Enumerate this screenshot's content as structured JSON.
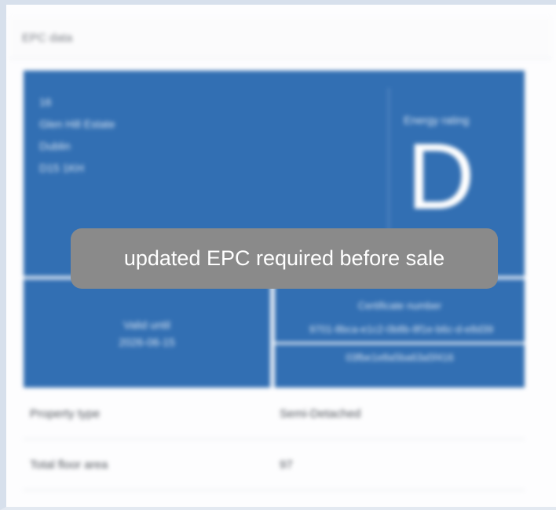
{
  "panel": {
    "title": "EPC data"
  },
  "address": [
    "16",
    "Glen Hill Estate",
    "Dublin",
    "D15 1KH"
  ],
  "energy_rating": {
    "label": "Energy rating",
    "letter": "D"
  },
  "valid_until": {
    "label": "Valid until",
    "date": "2026-06-15"
  },
  "certificate": {
    "label": "Certificate number",
    "number_line_1": "9701-8bca-e1c2-0b8b-8f1e-b6c-d-e8d39",
    "number_line_2": "03fbe1e8a5ba63a5f416"
  },
  "rows": [
    {
      "key": "Property type",
      "value": "Semi-Detached"
    },
    {
      "key": "Total floor area",
      "value": "97"
    }
  ],
  "toast": {
    "message": "updated EPC required before sale"
  },
  "colors": {
    "card": "#326fb3",
    "toast": "#8a8a8a"
  }
}
